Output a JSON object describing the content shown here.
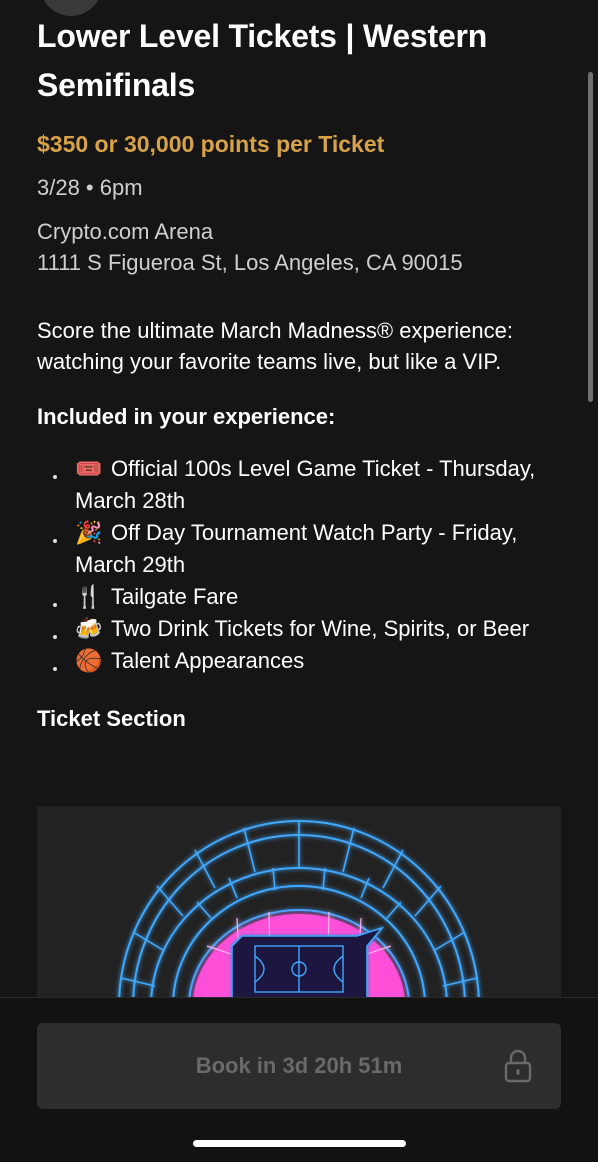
{
  "event": {
    "title": "Lower Level Tickets | Western Semifinals",
    "price": "$350 or 30,000 points per Ticket",
    "datetime": "3/28 • 6pm",
    "venue_name": "Crypto.com Arena",
    "venue_address": "1111 S Figueroa St, Los Angeles, CA 90015",
    "description": "Score the ultimate March Madness® experience: watching your favorite teams live, but like a VIP."
  },
  "included": {
    "heading": "Included in your experience:",
    "items": [
      {
        "icon": "🎟️",
        "text": "Official 100s Level Game Ticket  - Thursday, March 28th"
      },
      {
        "icon": "🎉",
        "text": "Off Day Tournament Watch Party - Friday, March 29th"
      },
      {
        "icon": "🍴",
        "text": "Tailgate Fare"
      },
      {
        "icon": "🍻",
        "text": "Two Drink Tickets for Wine, Spirits, or Beer"
      },
      {
        "icon": "🏀",
        "text": "Talent Appearances"
      }
    ]
  },
  "ticket_section": {
    "heading": "Ticket Section"
  },
  "booking": {
    "button_label": "Book in 3d 20h 51m",
    "icon": "lock-icon"
  },
  "colors": {
    "background": "#151515",
    "price_accent": "#d8a347",
    "neon_blue": "#3fa9ff",
    "neon_pink": "#ff4fd8",
    "button_bg": "#2d2d2d"
  }
}
